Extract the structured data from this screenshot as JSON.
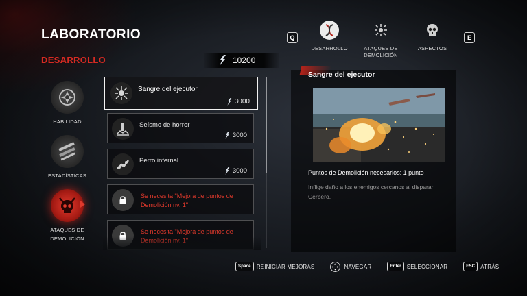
{
  "header": {
    "title": "LABORATORIO",
    "subtitle": "DESARROLLO"
  },
  "currency": {
    "amount": "10200",
    "icon": "demolition-points-icon"
  },
  "top_tabs": {
    "prev_key": "Q",
    "next_key": "E",
    "items": [
      {
        "label": "DESARROLLO",
        "icon": "dna-icon",
        "active": true
      },
      {
        "label": "ATAQUES DE DEMOLICIÓN",
        "icon": "explosion-icon",
        "active": false
      },
      {
        "label": "ASPECTOS",
        "icon": "skull-icon",
        "active": false
      }
    ]
  },
  "categories": [
    {
      "label": "HABILIDAD",
      "icon": "ability-emblem-icon",
      "active": false
    },
    {
      "label": "ESTADÍSTICAS",
      "icon": "weapons-icon",
      "active": false
    },
    {
      "label": "ATAQUES DE DEMOLICIÓN",
      "icon": "demon-skull-icon",
      "active": true
    }
  ],
  "upgrades": [
    {
      "name": "Sangre del ejecutor",
      "cost": "3000",
      "icon": "blood-splatter-icon",
      "selected": true,
      "locked": false
    },
    {
      "name": "Seísmo de horror",
      "cost": "3000",
      "icon": "ground-slam-icon",
      "selected": false,
      "locked": false
    },
    {
      "name": "Perro infernal",
      "cost": "3000",
      "icon": "hellhound-icon",
      "selected": false,
      "locked": false
    },
    {
      "lock_text": "Se necesita \"Mejora de puntos de Demolición nv. 1\"",
      "icon": "lock-icon",
      "locked": true
    },
    {
      "lock_text": "Se necesita \"Mejora de puntos de Demolición nv. 1\"",
      "icon": "lock-icon",
      "locked": true
    }
  ],
  "detail": {
    "title": "Sangre del ejecutor",
    "requirement": "Puntos de Demolición necesarios: 1 punto",
    "description": "Inflige daño a los enemigos cercanos al disparar Cerbero."
  },
  "hints": [
    {
      "key": "Space",
      "label": "REINICIAR MEJORAS"
    },
    {
      "key": "dpad",
      "label": "NAVEGAR"
    },
    {
      "key": "Enter",
      "label": "SELECCIONAR"
    },
    {
      "key": "ESC",
      "label": "ATRÁS"
    }
  ],
  "colors": {
    "accent_red": "#d62a22",
    "locked_text": "#e0392c",
    "active_tab_bg": "#ececec"
  }
}
